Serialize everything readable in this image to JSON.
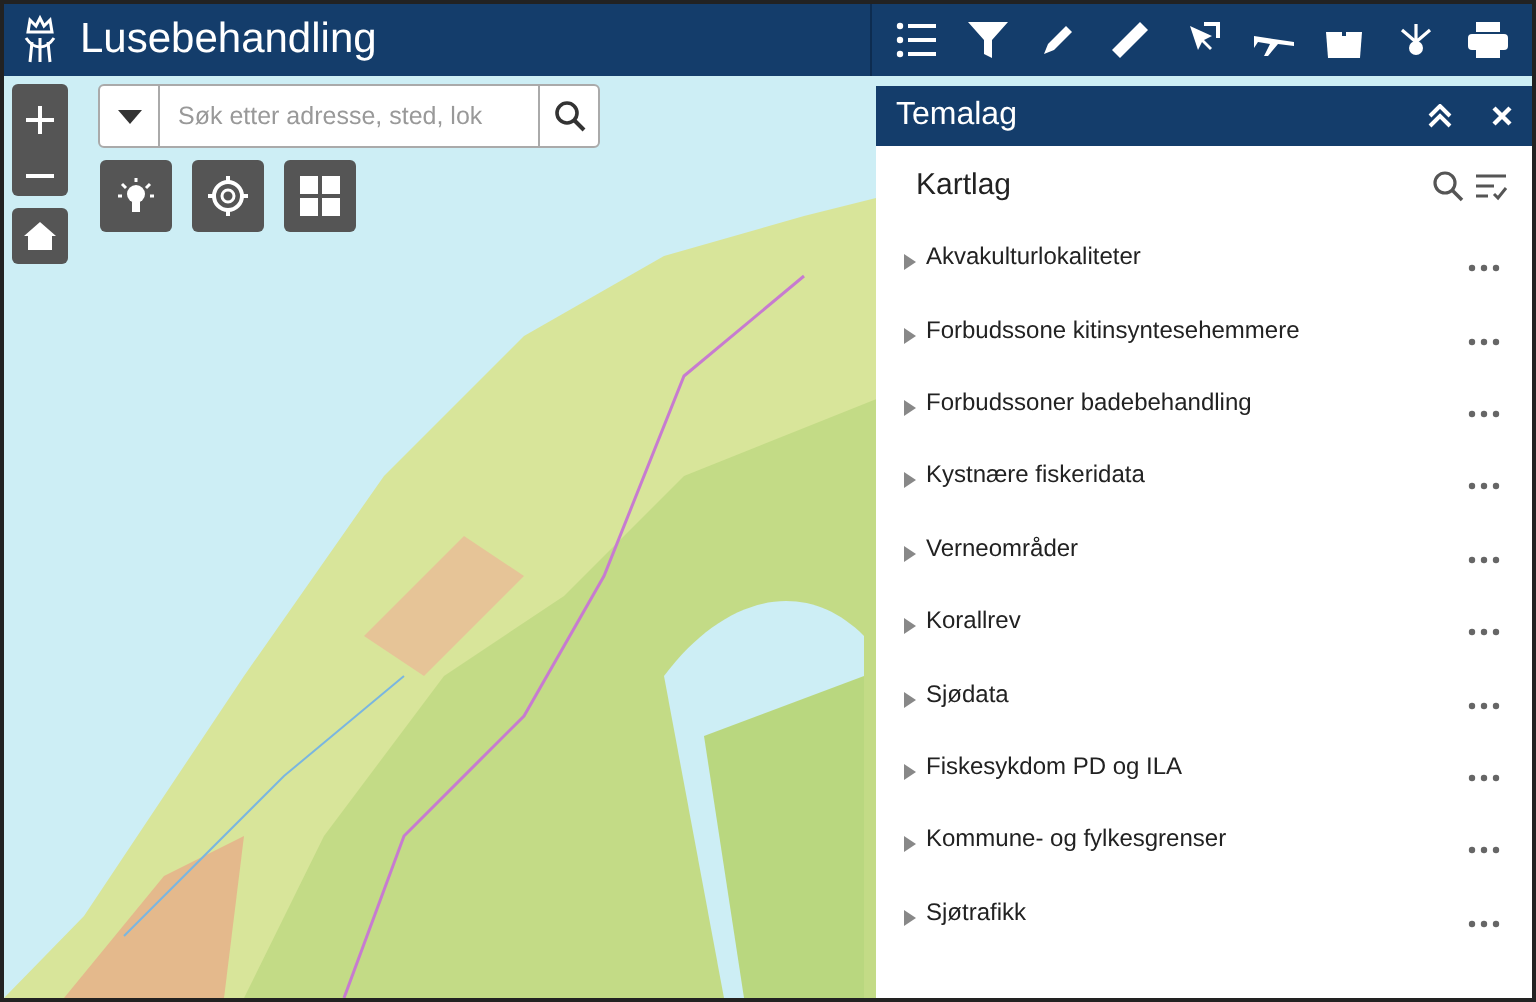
{
  "app": {
    "title": "Lusebehandling"
  },
  "search": {
    "placeholder": "Søk etter adresse, sted, lok"
  },
  "panel": {
    "title": "Temalag",
    "section_title": "Kartlag",
    "layers": [
      {
        "label": "Akvakulturlokaliteter",
        "expanded": false
      },
      {
        "label": "Forbudssone kitinsyntesehemmere",
        "expanded": false
      },
      {
        "label": "Forbudssoner badebehandling",
        "expanded": false
      },
      {
        "label": "Kystnære fiskeridata",
        "expanded": false
      },
      {
        "label": "Verneområder",
        "expanded": false
      },
      {
        "label": "Korallrev",
        "expanded": false
      },
      {
        "label": "Sjødata",
        "expanded": false
      },
      {
        "label": "Fiskesykdom PD og ILA",
        "expanded": false
      },
      {
        "label": "Kommune- og fylkesgrenser",
        "expanded": false
      },
      {
        "label": "Sjøtrafikk",
        "expanded": false
      }
    ]
  }
}
